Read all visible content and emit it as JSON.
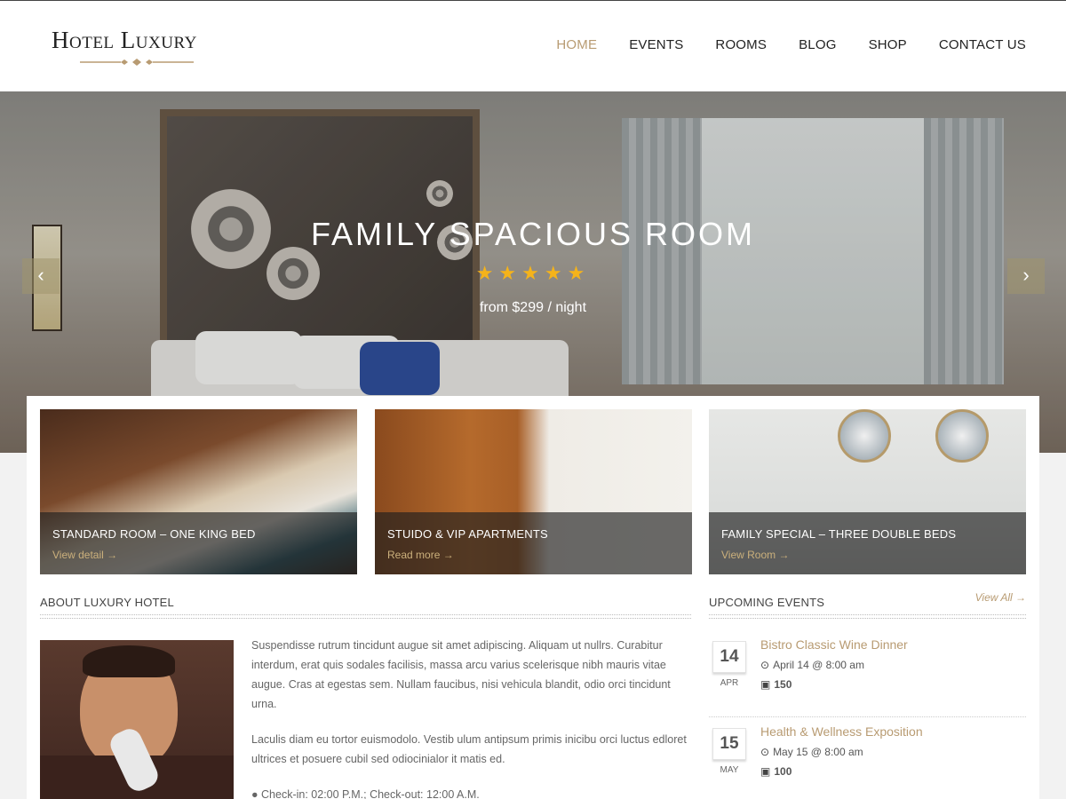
{
  "header": {
    "logo_text": "Hotel Luxury",
    "nav": [
      {
        "label": "HOME"
      },
      {
        "label": "EVENTS"
      },
      {
        "label": "ROOMS"
      },
      {
        "label": "BLOG"
      },
      {
        "label": "SHOP"
      },
      {
        "label": "CONTACT US"
      }
    ],
    "active_color": "#b89b72"
  },
  "hero": {
    "title": "FAMILY SPACIOUS ROOM",
    "rating": 5,
    "stars": "★★★★★",
    "price": "from $299 / night",
    "prev_icon": "chevron-left-icon",
    "next_icon": "chevron-right-icon",
    "prev_glyph": "‹",
    "next_glyph": "›"
  },
  "rooms": [
    {
      "title": "STANDARD ROOM – ONE KING BED",
      "link": "View detail →"
    },
    {
      "title": "STUIDO & VIP APARTMENTS",
      "link": "Read more →"
    },
    {
      "title": "FAMILY SPECIAL – THREE DOUBLE BEDS",
      "link": "View Room →"
    }
  ],
  "about": {
    "heading": "ABOUT LUXURY HOTEL",
    "paragraphs": [
      "Suspendisse rutrum tincidunt augue sit amet adipiscing. Aliquam ut nullrs. Curabitur interdum, erat quis sodales facilisis, massa arcu varius scelerisque nibh mauris vitae augue. Cras at egestas sem. Nullam faucibus, nisi vehicula blandit, odio orci tincidunt urna.",
      "Laculis diam eu tortor euismodolo. Vestib ulum antipsum primis inicibu orci luctus edloret ultrices et posuere cubil sed odiocinialor it matis ed.",
      "● Check-in: 02:00 P.M.; Check-out: 12:00 A.M."
    ]
  },
  "events": {
    "heading": "UPCOMING EVENTS",
    "view_all": "View All →",
    "clock_icon": "clock-icon",
    "ticket_icon": "ticket-icon",
    "items": [
      {
        "day": "14",
        "month": "APR",
        "title": "Bistro Classic Wine Dinner",
        "when": "April 14 @ 8:00 am",
        "seats": "150"
      },
      {
        "day": "15",
        "month": "MAY",
        "title": "Health & Wellness Exposition",
        "when": "May 15 @ 8:00 am",
        "seats": "100"
      }
    ]
  }
}
